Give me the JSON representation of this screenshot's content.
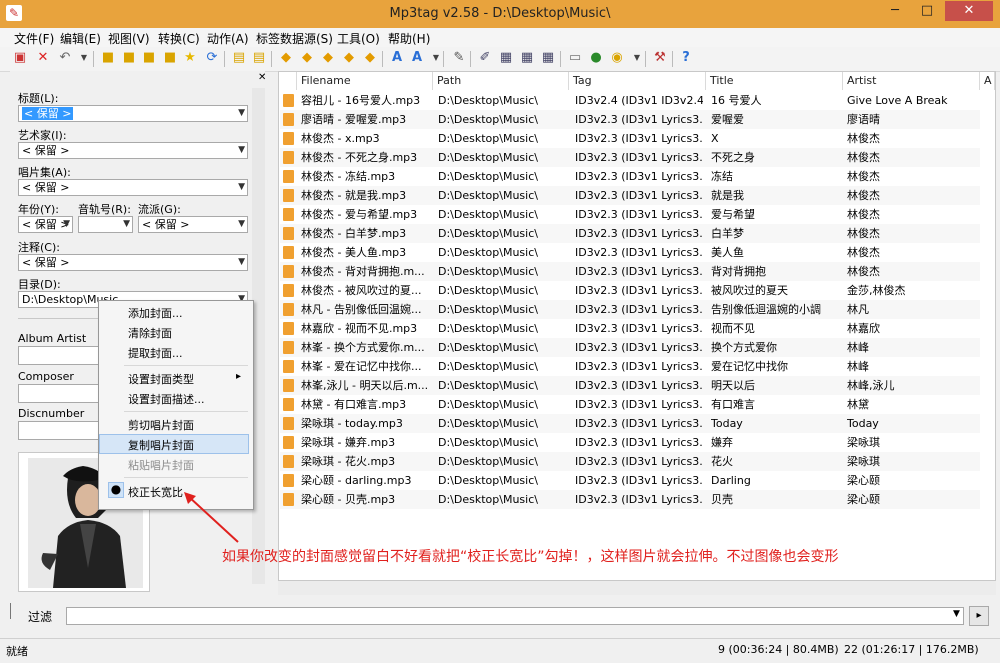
{
  "window": {
    "title": "Mp3tag v2.58  -  D:\\Desktop\\Music\\",
    "minimize": "─",
    "maximize": "□",
    "close": "✕"
  },
  "menu": [
    "文件(F)",
    "编辑(E)",
    "视图(V)",
    "转换(C)",
    "动作(A)",
    "标签数据源(S)",
    "工具(O)",
    "帮助(H)"
  ],
  "toolbar_icons": [
    "save-icon",
    "delete-icon",
    "undo-icon",
    "dropdown-icon",
    "open-folder-icon",
    "add-folder-icon",
    "folder-icon",
    "folder-star-icon",
    "favorite-star-icon",
    "refresh-icon",
    "export-icon",
    "import-icon",
    "tag-to-filename-icon",
    "filename-to-tag-icon",
    "text-to-tag-icon",
    "tag-to-text-icon",
    "tag-to-tag-icon",
    "actions-icon",
    "actions-dropdown-icon",
    "edit-icon",
    "script-icon",
    "playlist-icon",
    "sort-icon",
    "globe-icon",
    "freedb-icon",
    "discogs-icon",
    "dropdown-icon",
    "tools-icon",
    "help-icon"
  ],
  "tag_panel": {
    "title_label": "标题(L):",
    "title_value": "< 保留 >",
    "artist_label": "艺术家(I):",
    "artist_value": "< 保留 >",
    "album_label": "唱片集(A):",
    "album_value": "< 保留 >",
    "year_label": "年份(Y):",
    "year_value": "< 保留 >",
    "track_label": "音轨号(R):",
    "track_value": "",
    "genre_label": "流派(G):",
    "genre_value": "< 保留 >",
    "comment_label": "注释(C):",
    "comment_value": "< 保留 >",
    "directory_label": "目录(D):",
    "directory_value": "D:\\Desktop\\Music",
    "album_artist_label": "Album Artist",
    "composer_label": "Composer",
    "discnumber_label": "Discnumber"
  },
  "context_menu": {
    "items": [
      "添加封面...",
      "清除封面",
      "提取封面...",
      "设置封面类型",
      "设置封面描述...",
      "剪切唱片封面",
      "复制唱片封面",
      "粘贴唱片封面",
      "校正长宽比"
    ],
    "submenu_arrow": "▸",
    "highlighted": "复制唱片封面",
    "disabled": "粘贴唱片封面",
    "checked": "校正长宽比",
    "bullet": "●"
  },
  "columns": [
    "Filename",
    "Path",
    "Tag",
    "Title",
    "Artist",
    "A"
  ],
  "rows": [
    [
      "容祖儿 - 16号爱人.mp3",
      "D:\\Desktop\\Music\\",
      "ID3v2.4 (ID3v1 ID3v2.4)",
      "16 号爱人",
      "Give Love A Break"
    ],
    [
      "廖语晴 - 爱喔爱.mp3",
      "D:\\Desktop\\Music\\",
      "ID3v2.3 (ID3v1 Lyrics3...",
      "爱喔爱",
      "廖语晴"
    ],
    [
      "林俊杰 - x.mp3",
      "D:\\Desktop\\Music\\",
      "ID3v2.3 (ID3v1 Lyrics3...",
      "X",
      "林俊杰"
    ],
    [
      "林俊杰 - 不死之身.mp3",
      "D:\\Desktop\\Music\\",
      "ID3v2.3 (ID3v1 Lyrics3...",
      "不死之身",
      "林俊杰"
    ],
    [
      "林俊杰 - 冻结.mp3",
      "D:\\Desktop\\Music\\",
      "ID3v2.3 (ID3v1 Lyrics3...",
      "冻结",
      "林俊杰"
    ],
    [
      "林俊杰 - 就是我.mp3",
      "D:\\Desktop\\Music\\",
      "ID3v2.3 (ID3v1 Lyrics3...",
      "就是我",
      "林俊杰"
    ],
    [
      "林俊杰 - 爱与希望.mp3",
      "D:\\Desktop\\Music\\",
      "ID3v2.3 (ID3v1 Lyrics3...",
      "爱与希望",
      "林俊杰"
    ],
    [
      "林俊杰 - 白羊梦.mp3",
      "D:\\Desktop\\Music\\",
      "ID3v2.3 (ID3v1 Lyrics3...",
      "白羊梦",
      "林俊杰"
    ],
    [
      "林俊杰 - 美人鱼.mp3",
      "D:\\Desktop\\Music\\",
      "ID3v2.3 (ID3v1 Lyrics3...",
      "美人鱼",
      "林俊杰"
    ],
    [
      "林俊杰 - 背对背拥抱.m...",
      "D:\\Desktop\\Music\\",
      "ID3v2.3 (ID3v1 Lyrics3...",
      "背对背拥抱",
      "林俊杰"
    ],
    [
      "林俊杰 - 被风吹过的夏...",
      "D:\\Desktop\\Music\\",
      "ID3v2.3 (ID3v1 Lyrics3...",
      "被风吹过的夏天",
      "金莎,林俊杰"
    ],
    [
      "林凡 - 告别像低回温婉...",
      "D:\\Desktop\\Music\\",
      "ID3v2.3 (ID3v1 Lyrics3...",
      "告别像低迴溫婉的小調",
      "林凡"
    ],
    [
      "林嘉欣 - 视而不见.mp3",
      "D:\\Desktop\\Music\\",
      "ID3v2.3 (ID3v1 Lyrics3...",
      "视而不见",
      "林嘉欣"
    ],
    [
      "林峯 - 换个方式爱你.m...",
      "D:\\Desktop\\Music\\",
      "ID3v2.3 (ID3v1 Lyrics3...",
      "换个方式爱你",
      "林峰"
    ],
    [
      "林峯 - 爱在记忆中找你...",
      "D:\\Desktop\\Music\\",
      "ID3v2.3 (ID3v1 Lyrics3...",
      "爱在记忆中找你",
      "林峰"
    ],
    [
      "林峯,泳儿 - 明天以后.m...",
      "D:\\Desktop\\Music\\",
      "ID3v2.3 (ID3v1 Lyrics3...",
      "明天以后",
      "林峰,泳儿"
    ],
    [
      "林黛 - 有口难言.mp3",
      "D:\\Desktop\\Music\\",
      "ID3v2.3 (ID3v1 Lyrics3...",
      "有口难言",
      "林黛"
    ],
    [
      "梁咏琪 - today.mp3",
      "D:\\Desktop\\Music\\",
      "ID3v2.3 (ID3v1 Lyrics3...",
      "Today",
      "Today"
    ],
    [
      "梁咏琪 - 嫌弃.mp3",
      "D:\\Desktop\\Music\\",
      "ID3v2.3 (ID3v1 Lyrics3...",
      "嫌弃",
      "梁咏琪"
    ],
    [
      "梁咏琪 - 花火.mp3",
      "D:\\Desktop\\Music\\",
      "ID3v2.3 (ID3v1 Lyrics3...",
      "花火",
      "梁咏琪"
    ],
    [
      "梁心颐 - darling.mp3",
      "D:\\Desktop\\Music\\",
      "ID3v2.3 (ID3v1 Lyrics3...",
      "Darling",
      "梁心颐"
    ],
    [
      "梁心颐 - 贝壳.mp3",
      "D:\\Desktop\\Music\\",
      "ID3v2.3 (ID3v1 Lyrics3...",
      "贝壳",
      "梁心颐"
    ]
  ],
  "filter": {
    "label": "过滤",
    "value": ""
  },
  "status": {
    "left": "就绪",
    "selected": "9 (00:36:24 | 80.4MB)",
    "total": "22 (01:26:17 | 176.2MB)"
  },
  "annotation": "如果你改变的封面感觉留白不好看就把“校正长宽比”勾掉！，这样图片就会拉伸。不过图像也会变形",
  "colors": {
    "titlebar": "#e8a33d",
    "close": "#c7504a",
    "selection": "#3399ff",
    "annotation": "#e0211e",
    "file_icon": "#f0a030"
  }
}
